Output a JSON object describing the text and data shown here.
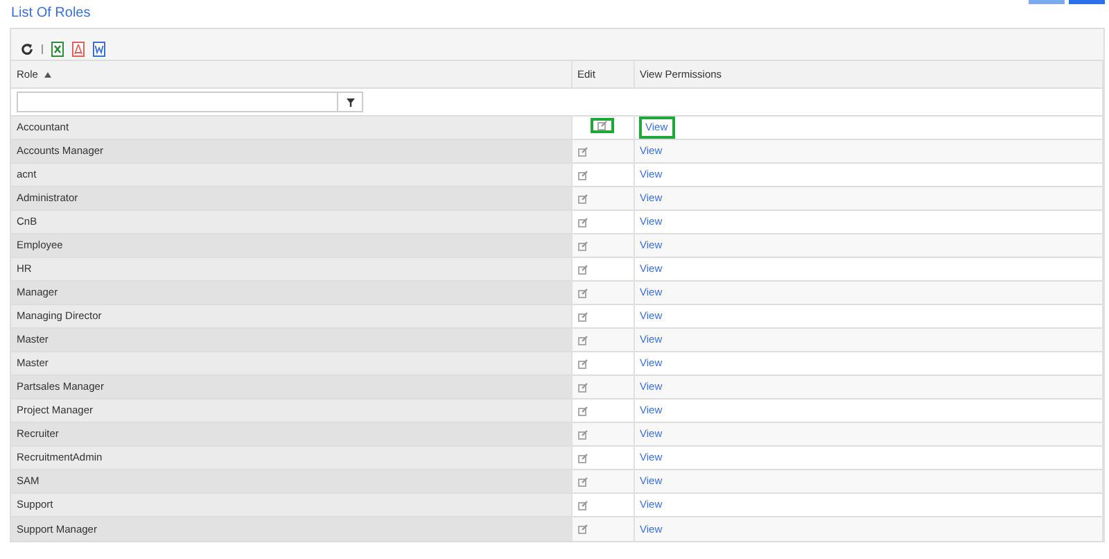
{
  "title": "List Of Roles",
  "columns": [
    {
      "label": "Role",
      "sorted": true
    },
    {
      "label": "Edit",
      "sorted": false
    },
    {
      "label": "View Permissions",
      "sorted": false
    }
  ],
  "rows": [
    {
      "role": "Accountant",
      "link": "View",
      "highlighted": true
    },
    {
      "role": "Accounts Manager",
      "link": "View",
      "highlighted": false
    },
    {
      "role": "acnt",
      "link": "View",
      "highlighted": false
    },
    {
      "role": "Administrator",
      "link": "View",
      "highlighted": false
    },
    {
      "role": "CnB",
      "link": "View",
      "highlighted": false
    },
    {
      "role": "Employee",
      "link": "View",
      "highlighted": false
    },
    {
      "role": "HR",
      "link": "View",
      "highlighted": false
    },
    {
      "role": "Manager",
      "link": "View",
      "highlighted": false
    },
    {
      "role": "Managing Director",
      "link": "View",
      "highlighted": false
    },
    {
      "role": "Master",
      "link": "View",
      "highlighted": false
    },
    {
      "role": "Master",
      "link": "View",
      "highlighted": false
    },
    {
      "role": "Partsales Manager",
      "link": "View",
      "highlighted": false
    },
    {
      "role": "Project Manager",
      "link": "View",
      "highlighted": false
    },
    {
      "role": "Recruiter",
      "link": "View",
      "highlighted": false
    },
    {
      "role": "RecruitmentAdmin",
      "link": "View",
      "highlighted": false
    },
    {
      "role": "SAM",
      "link": "View",
      "highlighted": false
    },
    {
      "role": "Support",
      "link": "View",
      "highlighted": false
    },
    {
      "role": "Support Manager",
      "link": "View",
      "highlighted": false
    }
  ]
}
